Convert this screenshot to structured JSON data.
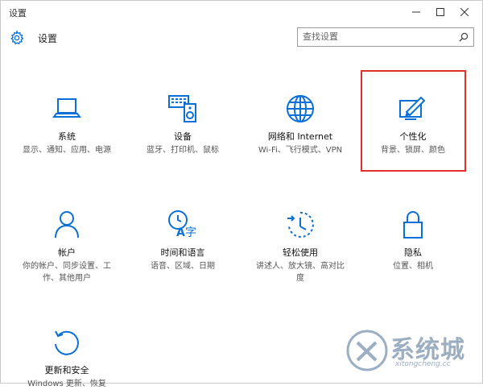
{
  "window": {
    "title": "设置"
  },
  "header": {
    "title": "设置",
    "search_placeholder": "查找设置"
  },
  "tiles": [
    {
      "title": "系统",
      "desc": "显示、通知、应用、电源",
      "icon": "laptop-icon"
    },
    {
      "title": "设备",
      "desc": "蓝牙、打印机、鼠标",
      "icon": "keyboard-speaker-icon"
    },
    {
      "title": "网络和 Internet",
      "desc": "Wi-Fi、飞行模式、VPN",
      "icon": "globe-icon"
    },
    {
      "title": "个性化",
      "desc": "背景、锁屏、颜色",
      "icon": "paint-icon",
      "highlighted": true
    },
    {
      "title": "帐户",
      "desc": "你的帐户、同步设置、工作、其他用户",
      "icon": "person-icon"
    },
    {
      "title": "时间和语言",
      "desc": "语音、区域、日期",
      "icon": "time-language-icon"
    },
    {
      "title": "轻松使用",
      "desc": "讲述人、放大镜、高对比度",
      "icon": "ease-of-access-icon"
    },
    {
      "title": "隐私",
      "desc": "位置、相机",
      "icon": "lock-icon"
    },
    {
      "title": "更新和安全",
      "desc": "Windows 更新、恢复",
      "icon": "update-icon"
    }
  ],
  "colors": {
    "accent": "#0a6fd6",
    "highlight": "#e0302c"
  },
  "watermark": {
    "text": "系统城",
    "sub": "xitongcheng.cc"
  }
}
